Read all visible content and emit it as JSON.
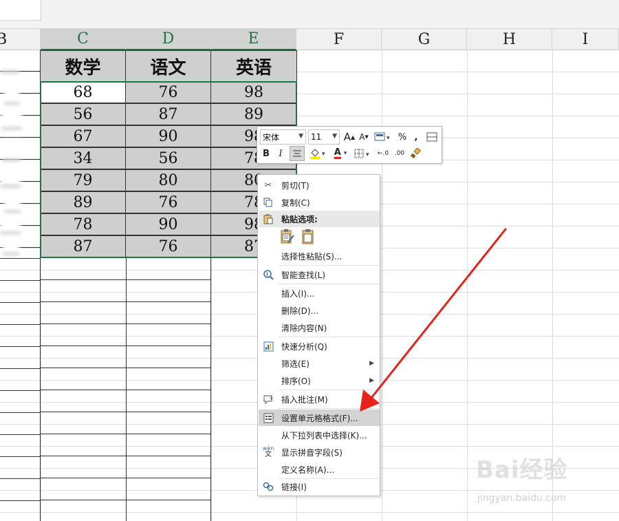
{
  "columns": [
    "B",
    "C",
    "D",
    "E",
    "F",
    "G",
    "H",
    "I"
  ],
  "table": {
    "headers": [
      "数学",
      "语文",
      "英语"
    ],
    "rows": [
      [
        "68",
        "76",
        "98"
      ],
      [
        "56",
        "87",
        "89"
      ],
      [
        "67",
        "90",
        "98"
      ],
      [
        "34",
        "56",
        "78"
      ],
      [
        "79",
        "80",
        "80"
      ],
      [
        "89",
        "76",
        "78"
      ],
      [
        "78",
        "90",
        "98"
      ],
      [
        "87",
        "76",
        "87"
      ]
    ]
  },
  "mini_toolbar": {
    "font_name": "宋体",
    "font_size": "11",
    "grow_font": "A",
    "shrink_font": "A",
    "percent": "%",
    "comma": ",",
    "bold": "B",
    "italic": "I",
    "font_color_letter": "A",
    "inc_decimal": "←.0",
    "dec_decimal": ".00"
  },
  "context_menu": {
    "items": [
      {
        "label": "剪切(T)",
        "icon": "scissors-icon"
      },
      {
        "label": "复制(C)",
        "icon": "copy-icon"
      },
      {
        "label": "粘贴选项:",
        "icon": "paste-icon"
      },
      {
        "label": "选择性粘贴(S)...",
        "icon": ""
      },
      {
        "label": "智能查找(L)",
        "icon": "smart-lookup-icon"
      },
      {
        "label": "插入(I)...",
        "icon": ""
      },
      {
        "label": "删除(D)...",
        "icon": ""
      },
      {
        "label": "清除内容(N)",
        "icon": ""
      },
      {
        "label": "快速分析(Q)",
        "icon": "quick-analysis-icon"
      },
      {
        "label": "筛选(E)",
        "icon": ""
      },
      {
        "label": "排序(O)",
        "icon": ""
      },
      {
        "label": "插入批注(M)",
        "icon": "comment-icon"
      },
      {
        "label": "设置单元格格式(F)...",
        "icon": "format-cells-icon"
      },
      {
        "label": "从下拉列表中选择(K)...",
        "icon": ""
      },
      {
        "label": "显示拼音字段(S)",
        "icon": "phonetic-icon"
      },
      {
        "label": "定义名称(A)...",
        "icon": ""
      },
      {
        "label": "链接(I)",
        "icon": "link-icon"
      }
    ],
    "phonetic_icon_text": "wén",
    "phonetic_icon_char": "文"
  },
  "watermark": {
    "brand": "Bai经验",
    "url": "jingyan.baidu.com"
  },
  "colors": {
    "selection_border": "#217346",
    "arrow": "#e8221b",
    "menu_highlight": "#d4d4d4"
  }
}
